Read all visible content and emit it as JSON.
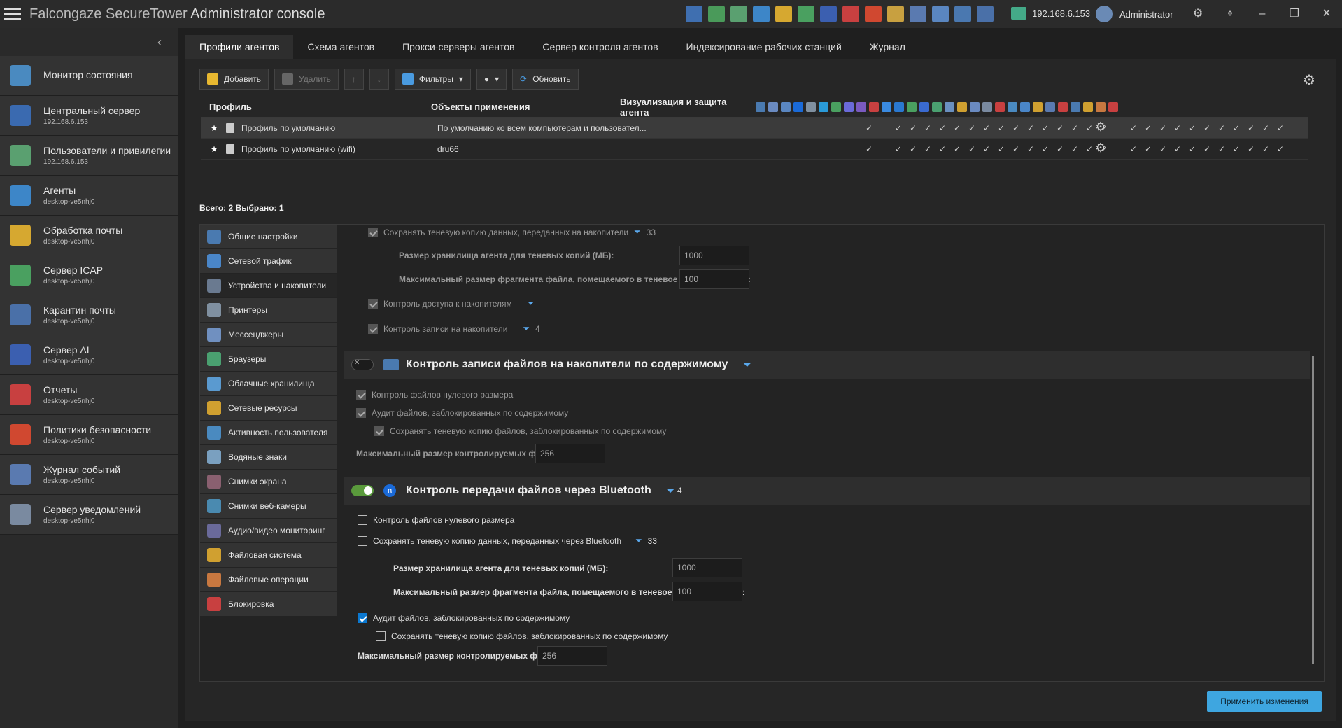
{
  "app": {
    "title_brand": "Falcongaze SecureTower",
    "title_rest": "Administrator console",
    "ip": "192.168.6.153",
    "user": "Administrator"
  },
  "sidebar": {
    "items": [
      {
        "label": "Монитор состояния",
        "sub": ""
      },
      {
        "label": "Центральный сервер",
        "sub": "192.168.6.153"
      },
      {
        "label": "Пользователи и привилегии",
        "sub": "192.168.6.153"
      },
      {
        "label": "Агенты",
        "sub": "desktop-ve5nhj0"
      },
      {
        "label": "Обработка почты",
        "sub": "desktop-ve5nhj0"
      },
      {
        "label": "Сервер ICAP",
        "sub": "desktop-ve5nhj0"
      },
      {
        "label": "Карантин почты",
        "sub": "desktop-ve5nhj0"
      },
      {
        "label": "Сервер AI",
        "sub": "desktop-ve5nhj0"
      },
      {
        "label": "Отчеты",
        "sub": "desktop-ve5nhj0"
      },
      {
        "label": "Политики безопасности",
        "sub": "desktop-ve5nhj0"
      },
      {
        "label": "Журнал событий",
        "sub": "desktop-ve5nhj0"
      },
      {
        "label": "Сервер уведомлений",
        "sub": "desktop-ve5nhj0"
      }
    ]
  },
  "tabs": [
    "Профили агентов",
    "Схема агентов",
    "Прокси-серверы агентов",
    "Сервер контроля агентов",
    "Индексирование рабочих станций",
    "Журнал"
  ],
  "toolbar": {
    "add": "Добавить",
    "delete": "Удалить",
    "filters": "Фильтры",
    "refresh": "Обновить"
  },
  "table": {
    "headers": [
      "Профиль",
      "Объекты применения",
      "Визуализация и защита агента"
    ],
    "rows": [
      {
        "name": "Профиль по умолчанию",
        "objects": "По умолчанию ко всем компьютерам и пользовател..."
      },
      {
        "name": "Профиль по умолчанию (wifi)",
        "objects": "dru66"
      }
    ],
    "check": "✓"
  },
  "total": {
    "label_total": "Всего:",
    "total": "2",
    "label_selected": "Выбрано:",
    "selected": "1"
  },
  "nav": [
    "Общие настройки",
    "Сетевой трафик",
    "Устройства и накопители",
    "Принтеры",
    "Мессенджеры",
    "Браузеры",
    "Облачные хранилища",
    "Сетевые ресурсы",
    "Активность пользователя",
    "Водяные знаки",
    "Снимки экрана",
    "Снимки веб-камеры",
    "Аудио/видео мониторинг",
    "Файловая система",
    "Файловые операции",
    "Блокировка"
  ],
  "settings": {
    "shadow_copy_storage": "Сохранять теневую копию данных, переданных на накопители",
    "shadow_count": "33",
    "storage_size_label": "Размер хранилища агента для теневых копий (МБ):",
    "storage_size": "1000",
    "max_fragment_label": "Максимальный размер фрагмента файла, помещаемого в теневое хранилище (МБ):",
    "max_fragment": "100",
    "access_control": "Контроль доступа к накопителям",
    "write_control": "Контроль записи на накопители",
    "write_count": "4",
    "sec1_title": "Контроль записи файлов на накопители по содержимому",
    "zero_size": "Контроль файлов нулевого размера",
    "audit_blocked": "Аудит файлов, заблокированных по содержимому",
    "shadow_blocked": "Сохранять теневую копию файлов, заблокированных по содержимому",
    "max_controlled_label": "Максимальный размер контролируемых файлов (МБ):",
    "max_controlled": "256",
    "sec2_title": "Контроль передачи файлов через Bluetooth",
    "sec2_count": "4",
    "bt_shadow": "Сохранять теневую копию данных, переданных через Bluetooth",
    "bt_shadow_count": "33",
    "bt_storage_size": "1000",
    "bt_max_fragment": "100",
    "bt_max_controlled": "256"
  },
  "apply": "Применить изменения",
  "colors": {
    "accent": "#3ea6e0",
    "toggle_on": "#5a9a3c"
  }
}
